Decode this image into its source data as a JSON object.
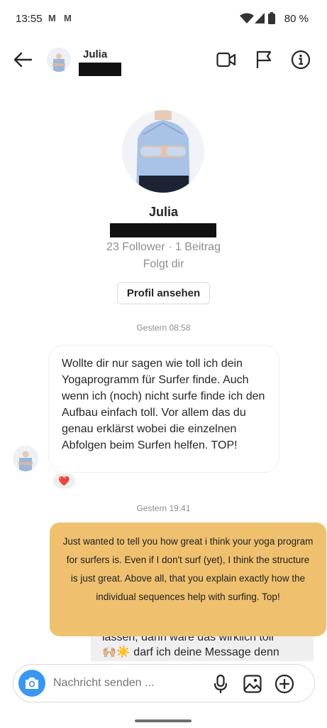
{
  "status_bar": {
    "time": "13:55",
    "notif_1": "M",
    "notif_2": "M",
    "battery_pct": "80 %"
  },
  "header": {
    "name": "Julia"
  },
  "profile": {
    "name": "Julia",
    "stats": "23 Follower · 1 Beitrag",
    "follows_you": "Folgt dir",
    "view_profile_label": "Profil ansehen"
  },
  "messages": {
    "ts1": "Gestern 08:58",
    "incoming_text": "Wollte dir nur sagen wie toll ich dein Yogaprogramm für Surfer finde. Auch wenn ich (noch) nicht surfe finde ich den Aufbau einfach toll. Vor allem das du genau erklärst wobei die einzelnen Abfolgen beim Surfen helfen. TOP!",
    "reaction": "❤️",
    "ts2": "Gestern 19:41",
    "translation_text": "Just wanted to tell you how great i think your yoga program for surfers is. Even if I don't surf (yet), I think the structure is just great. Above all, that you explain exactly how the individual sequences help with surfing. Top!",
    "partial_line_1": "lassen, dann wäre das wirklich toll",
    "partial_line_2": "🙌🏼☀️ darf ich deine Message denn"
  },
  "composer": {
    "placeholder": "Nachricht senden ..."
  },
  "colors": {
    "camera_blue": "#3897f0",
    "translation_bg": "#efc06e"
  }
}
